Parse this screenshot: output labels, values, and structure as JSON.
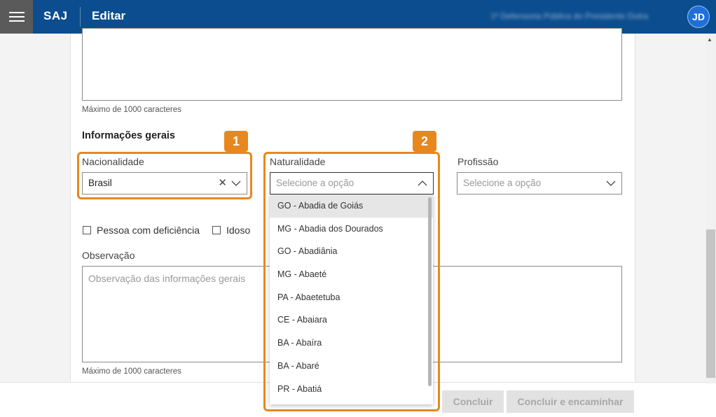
{
  "header": {
    "brand": "SAJ",
    "title": "Editar",
    "user_name": "1ª Defensoria Pública do Presidente Dutra",
    "avatar_initials": "JD"
  },
  "top_field": {
    "hint": "Máximo de 1000 caracteres"
  },
  "general": {
    "section_title": "Informações gerais",
    "nacionalidade": {
      "label": "Nacionalidade",
      "value": "Brasil"
    },
    "naturalidade": {
      "label": "Naturalidade",
      "placeholder": "Selecione a opção"
    },
    "profissao": {
      "label": "Profissão",
      "placeholder": "Selecione a opção"
    },
    "checkboxes": [
      "Pessoa com deficiência",
      "Idoso"
    ],
    "observacao": {
      "label": "Observação",
      "placeholder": "Observação das informações gerais",
      "hint": "Máximo de 1000 caracteres"
    }
  },
  "dropdown_options": [
    "GO - Abadia de Goiás",
    "MG - Abadia dos Dourados",
    "GO - Abadiânia",
    "MG - Abaeté",
    "PA - Abaetetuba",
    "CE - Abaiara",
    "BA - Abaíra",
    "BA - Abaré",
    "PR - Abatiá"
  ],
  "callouts": [
    "1",
    "2"
  ],
  "footer": {
    "concluir": "Concluir",
    "concluir_encaminhar": "Concluir e encaminhar"
  },
  "colors": {
    "header_bg": "#0b4d8f",
    "callout": "#e8871e",
    "avatar_bg": "#1e6fd9"
  }
}
